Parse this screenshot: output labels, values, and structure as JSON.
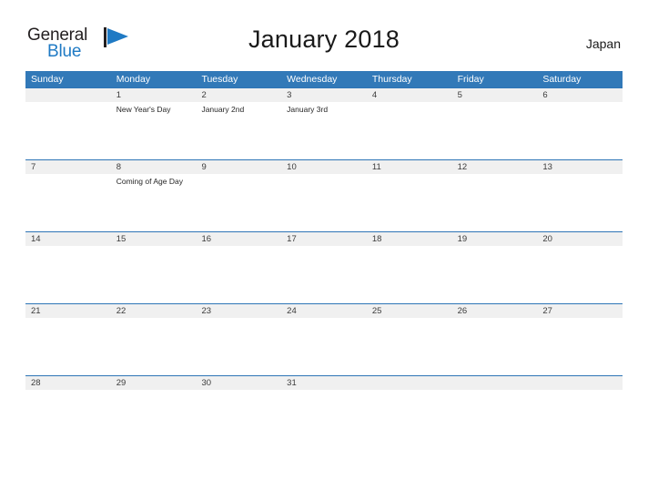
{
  "brand": {
    "name_part1": "General",
    "name_part2": "Blue",
    "logo_icon": "blue-flag-triangle-icon",
    "color_dark": "#231f20",
    "color_blue": "#1f7ac4"
  },
  "header": {
    "title": "January 2018",
    "country": "Japan"
  },
  "theme": {
    "header_blue": "#3279b8",
    "row_divider_blue": "#2e75b6",
    "daynum_band_gray": "#f0f0f0",
    "page_background": "#ffffff"
  },
  "calendar": {
    "weekday_headers": [
      "Sunday",
      "Monday",
      "Tuesday",
      "Wednesday",
      "Thursday",
      "Friday",
      "Saturday"
    ],
    "weeks": [
      {
        "days": [
          {
            "num": "",
            "event": ""
          },
          {
            "num": "1",
            "event": "New Year's Day"
          },
          {
            "num": "2",
            "event": "January 2nd"
          },
          {
            "num": "3",
            "event": "January 3rd"
          },
          {
            "num": "4",
            "event": ""
          },
          {
            "num": "5",
            "event": ""
          },
          {
            "num": "6",
            "event": ""
          }
        ]
      },
      {
        "days": [
          {
            "num": "7",
            "event": ""
          },
          {
            "num": "8",
            "event": "Coming of Age Day"
          },
          {
            "num": "9",
            "event": ""
          },
          {
            "num": "10",
            "event": ""
          },
          {
            "num": "11",
            "event": ""
          },
          {
            "num": "12",
            "event": ""
          },
          {
            "num": "13",
            "event": ""
          }
        ]
      },
      {
        "days": [
          {
            "num": "14",
            "event": ""
          },
          {
            "num": "15",
            "event": ""
          },
          {
            "num": "16",
            "event": ""
          },
          {
            "num": "17",
            "event": ""
          },
          {
            "num": "18",
            "event": ""
          },
          {
            "num": "19",
            "event": ""
          },
          {
            "num": "20",
            "event": ""
          }
        ]
      },
      {
        "days": [
          {
            "num": "21",
            "event": ""
          },
          {
            "num": "22",
            "event": ""
          },
          {
            "num": "23",
            "event": ""
          },
          {
            "num": "24",
            "event": ""
          },
          {
            "num": "25",
            "event": ""
          },
          {
            "num": "26",
            "event": ""
          },
          {
            "num": "27",
            "event": ""
          }
        ]
      },
      {
        "days": [
          {
            "num": "28",
            "event": ""
          },
          {
            "num": "29",
            "event": ""
          },
          {
            "num": "30",
            "event": ""
          },
          {
            "num": "31",
            "event": ""
          },
          {
            "num": "",
            "event": ""
          },
          {
            "num": "",
            "event": ""
          },
          {
            "num": "",
            "event": ""
          }
        ]
      }
    ]
  }
}
